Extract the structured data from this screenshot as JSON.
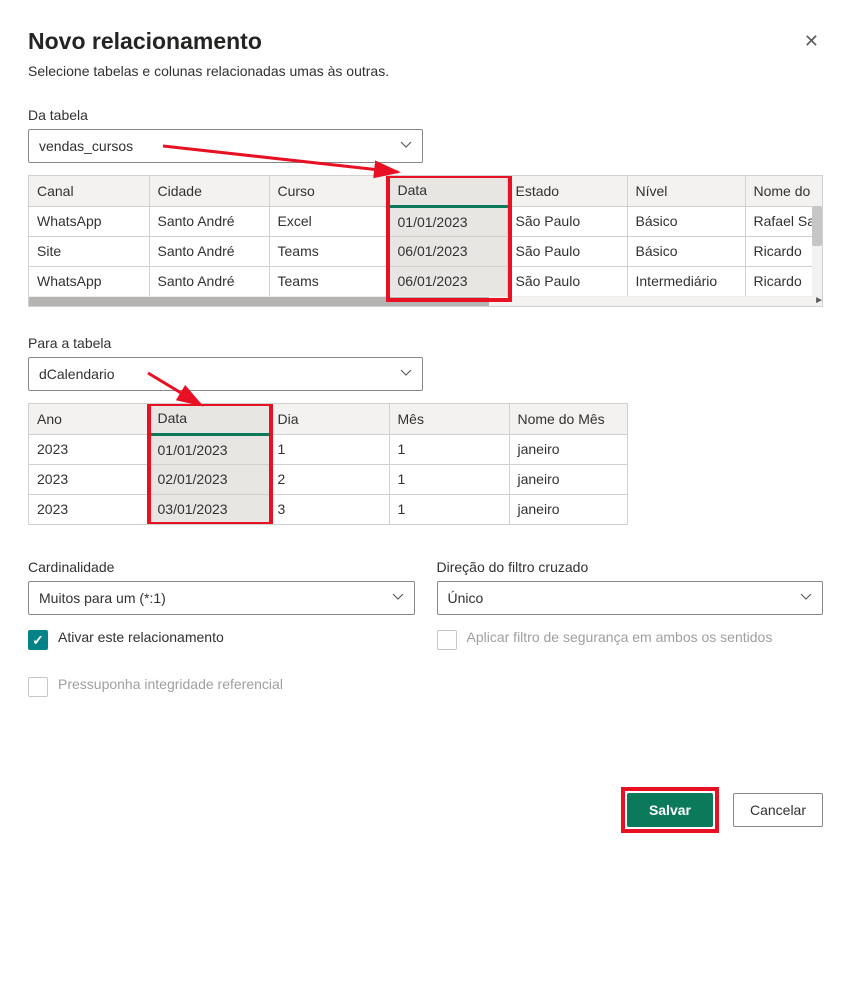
{
  "dialog": {
    "title": "Novo relacionamento",
    "subtitle": "Selecione tabelas e colunas relacionadas umas às outras."
  },
  "from": {
    "label": "Da tabela",
    "selected": "vendas_cursos",
    "columns": [
      "Canal",
      "Cidade",
      "Curso",
      "Data",
      "Estado",
      "Nível",
      "Nome do"
    ],
    "rows": [
      {
        "Canal": "WhatsApp",
        "Cidade": "Santo André",
        "Curso": "Excel",
        "Data": "01/01/2023",
        "Estado": "São Paulo",
        "Nível": "Básico",
        "Nome": "Rafael Sa"
      },
      {
        "Canal": "Site",
        "Cidade": "Santo André",
        "Curso": "Teams",
        "Data": "06/01/2023",
        "Estado": "São Paulo",
        "Nível": "Básico",
        "Nome": "Ricardo"
      },
      {
        "Canal": "WhatsApp",
        "Cidade": "Santo André",
        "Curso": "Teams",
        "Data": "06/01/2023",
        "Estado": "São Paulo",
        "Nível": "Intermediário",
        "Nome": "Ricardo"
      }
    ]
  },
  "to": {
    "label": "Para a tabela",
    "selected": "dCalendario",
    "columns": [
      "Ano",
      "Data",
      "Dia",
      "Mês",
      "Nome do Mês"
    ],
    "rows": [
      {
        "Ano": "2023",
        "Data": "01/01/2023",
        "Dia": "1",
        "Mes": "1",
        "NomeMes": "janeiro"
      },
      {
        "Ano": "2023",
        "Data": "02/01/2023",
        "Dia": "2",
        "Mes": "1",
        "NomeMes": "janeiro"
      },
      {
        "Ano": "2023",
        "Data": "03/01/2023",
        "Dia": "3",
        "Mes": "1",
        "NomeMes": "janeiro"
      }
    ]
  },
  "cardinality": {
    "label": "Cardinalidade",
    "value": "Muitos para um (*:1)"
  },
  "crossfilter": {
    "label": "Direção do filtro cruzado",
    "value": "Único"
  },
  "checks": {
    "activate": "Ativar este relacionamento",
    "security": "Aplicar filtro de segurança em ambos os sentidos",
    "integrity": "Pressuponha integridade referencial"
  },
  "buttons": {
    "save": "Salvar",
    "cancel": "Cancelar"
  }
}
